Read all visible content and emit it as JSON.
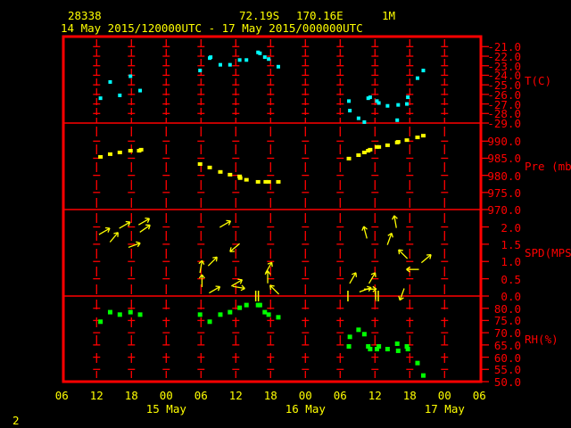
{
  "header": {
    "station": "28338",
    "latitude": "72.19S",
    "longitude": "170.16E",
    "elevation": "1M",
    "period": "14 May 2015/120000UTC - 17 May 2015/000000UTC"
  },
  "footer": {
    "page": "2"
  },
  "colors": {
    "frame": "#ff0000",
    "text": "#ffff00",
    "temperature": "#00ffff",
    "pressure": "#ffff00",
    "wind": "#ffff00",
    "humidity": "#00ff00"
  },
  "chart_data": {
    "type": "scatter",
    "x_axis": {
      "range": [
        "2015-05-14T06:00",
        "2015-05-17T06:00"
      ],
      "tick_labels": [
        "06",
        "12",
        "18",
        "00",
        "06",
        "12",
        "18",
        "00",
        "06",
        "12",
        "18",
        "00",
        "06"
      ],
      "date_labels": [
        {
          "label": "15 May",
          "at": "2015-05-15T00:00"
        },
        {
          "label": "16 May",
          "at": "2015-05-16T00:00"
        },
        {
          "label": "17 May",
          "at": "2015-05-17T00:00"
        }
      ]
    },
    "panels": [
      {
        "id": "temperature",
        "ylabel": "T(C)",
        "ylim": [
          -29,
          -21
        ],
        "tick_labels": [
          "-21.0",
          "-22.0",
          "-23.0",
          "-24.0",
          "-25.0",
          "-26.0",
          "-27.0",
          "-28.0",
          "-29.0"
        ],
        "tick_values": [
          -21,
          -22,
          -23,
          -24,
          -25,
          -26,
          -27,
          -28,
          -29
        ],
        "points": [
          {
            "t": "2015-05-14T12:40",
            "v": -26.4
          },
          {
            "t": "2015-05-14T14:20",
            "v": -24.7
          },
          {
            "t": "2015-05-14T16:00",
            "v": -26.1
          },
          {
            "t": "2015-05-14T17:50",
            "v": -24.1
          },
          {
            "t": "2015-05-14T19:30",
            "v": -25.6
          },
          {
            "t": "2015-05-15T05:50",
            "v": -23.5
          },
          {
            "t": "2015-05-15T07:30",
            "v": -22.2
          },
          {
            "t": "2015-05-15T07:40",
            "v": -22.1
          },
          {
            "t": "2015-05-15T09:20",
            "v": -22.9
          },
          {
            "t": "2015-05-15T11:00",
            "v": -22.9
          },
          {
            "t": "2015-05-15T12:40",
            "v": -22.4
          },
          {
            "t": "2015-05-15T13:50",
            "v": -22.4
          },
          {
            "t": "2015-05-15T15:50",
            "v": -21.6
          },
          {
            "t": "2015-05-15T16:10",
            "v": -21.7
          },
          {
            "t": "2015-05-15T17:00",
            "v": -22.1
          },
          {
            "t": "2015-05-15T17:40",
            "v": -22.3
          },
          {
            "t": "2015-05-15T19:20",
            "v": -23.1
          },
          {
            "t": "2015-05-16T07:30",
            "v": -26.7
          },
          {
            "t": "2015-05-16T07:40",
            "v": -27.7
          },
          {
            "t": "2015-05-16T09:10",
            "v": -28.5
          },
          {
            "t": "2015-05-16T10:10",
            "v": -28.9
          },
          {
            "t": "2015-05-16T10:50",
            "v": -26.4
          },
          {
            "t": "2015-05-16T11:10",
            "v": -26.3
          },
          {
            "t": "2015-05-16T12:20",
            "v": -26.7
          },
          {
            "t": "2015-05-16T12:40",
            "v": -26.9
          },
          {
            "t": "2015-05-16T14:10",
            "v": -27.2
          },
          {
            "t": "2015-05-16T15:50",
            "v": -28.7
          },
          {
            "t": "2015-05-16T16:00",
            "v": -27.1
          },
          {
            "t": "2015-05-16T17:30",
            "v": -27.0
          },
          {
            "t": "2015-05-16T17:40",
            "v": -26.3
          },
          {
            "t": "2015-05-16T19:20",
            "v": -24.3
          },
          {
            "t": "2015-05-16T20:20",
            "v": -23.5
          }
        ]
      },
      {
        "id": "pressure",
        "ylabel": "Pre (mb)",
        "ylim": [
          970,
          990
        ],
        "tick_labels": [
          "990.0",
          "985.0",
          "980.0",
          "975.0",
          "970.0"
        ],
        "tick_values": [
          990,
          985,
          980,
          975,
          970
        ],
        "points": [
          {
            "t": "2015-05-14T12:40",
            "v": 985.4
          },
          {
            "t": "2015-05-14T14:20",
            "v": 986.2
          },
          {
            "t": "2015-05-14T16:00",
            "v": 986.7
          },
          {
            "t": "2015-05-14T17:50",
            "v": 987.2
          },
          {
            "t": "2015-05-14T19:20",
            "v": 987.2
          },
          {
            "t": "2015-05-14T19:40",
            "v": 987.5
          },
          {
            "t": "2015-05-15T05:50",
            "v": 983.3
          },
          {
            "t": "2015-05-15T07:30",
            "v": 982.3
          },
          {
            "t": "2015-05-15T09:20",
            "v": 981.0
          },
          {
            "t": "2015-05-15T11:00",
            "v": 980.2
          },
          {
            "t": "2015-05-15T12:40",
            "v": 979.7
          },
          {
            "t": "2015-05-15T12:45",
            "v": 979.2
          },
          {
            "t": "2015-05-15T13:50",
            "v": 978.7
          },
          {
            "t": "2015-05-15T15:50",
            "v": 978.1
          },
          {
            "t": "2015-05-15T17:10",
            "v": 978.1
          },
          {
            "t": "2015-05-15T17:40",
            "v": 978.1
          },
          {
            "t": "2015-05-15T19:20",
            "v": 978.1
          },
          {
            "t": "2015-05-16T07:30",
            "v": 984.9
          },
          {
            "t": "2015-05-16T09:10",
            "v": 985.9
          },
          {
            "t": "2015-05-16T10:10",
            "v": 986.7
          },
          {
            "t": "2015-05-16T10:50",
            "v": 987.2
          },
          {
            "t": "2015-05-16T11:10",
            "v": 987.5
          },
          {
            "t": "2015-05-16T12:20",
            "v": 988.3
          },
          {
            "t": "2015-05-16T12:40",
            "v": 988.3
          },
          {
            "t": "2015-05-16T14:10",
            "v": 988.8
          },
          {
            "t": "2015-05-16T15:50",
            "v": 989.6
          },
          {
            "t": "2015-05-16T16:00",
            "v": 989.8
          },
          {
            "t": "2015-05-16T17:30",
            "v": 990.3
          },
          {
            "t": "2015-05-16T19:20",
            "v": 991.1
          },
          {
            "t": "2015-05-16T20:20",
            "v": 991.6
          }
        ]
      },
      {
        "id": "wind",
        "ylabel": "SPD(MPS)",
        "ylim": [
          0,
          2
        ],
        "tick_labels": [
          "2.0",
          "1.5",
          "1.0",
          "0.5",
          "0.0"
        ],
        "tick_values": [
          2,
          1.5,
          1,
          0.5,
          0
        ],
        "arrows": [
          {
            "t": "2015-05-14T13:20",
            "v": 1.87,
            "bearing": 60
          },
          {
            "t": "2015-05-14T15:00",
            "v": 1.7,
            "bearing": 40
          },
          {
            "t": "2015-05-14T16:50",
            "v": 2.05,
            "bearing": 60
          },
          {
            "t": "2015-05-14T20:10",
            "v": 2.15,
            "bearing": 60
          },
          {
            "t": "2015-05-14T20:20",
            "v": 1.95,
            "bearing": 55
          },
          {
            "t": "2015-05-14T18:30",
            "v": 1.47,
            "bearing": 70
          },
          {
            "t": "2015-05-15T10:10",
            "v": 2.08,
            "bearing": 60
          },
          {
            "t": "2015-05-15T11:50",
            "v": 1.4,
            "bearing": 230
          },
          {
            "t": "2015-05-15T06:00",
            "v": 0.85,
            "bearing": 10
          },
          {
            "t": "2015-05-15T08:00",
            "v": 1.0,
            "bearing": 45
          },
          {
            "t": "2015-05-15T06:10",
            "v": 0.44,
            "bearing": 0
          },
          {
            "t": "2015-05-15T08:20",
            "v": 0.18,
            "bearing": 60
          },
          {
            "t": "2015-05-15T12:10",
            "v": 0.38,
            "bearing": 60
          },
          {
            "t": "2015-05-15T12:30",
            "v": 0.25,
            "bearing": 100
          },
          {
            "t": "2015-05-15T17:40",
            "v": 0.82,
            "bearing": 30
          },
          {
            "t": "2015-05-15T17:30",
            "v": 0.55,
            "bearing": 0
          },
          {
            "t": "2015-05-15T18:40",
            "v": 0.18,
            "bearing": 315
          },
          {
            "t": "2015-05-16T15:30",
            "v": 2.15,
            "bearing": 350
          },
          {
            "t": "2015-05-16T10:20",
            "v": 1.84,
            "bearing": 345
          },
          {
            "t": "2015-05-16T14:30",
            "v": 1.65,
            "bearing": 20
          },
          {
            "t": "2015-05-16T16:50",
            "v": 1.21,
            "bearing": 315
          },
          {
            "t": "2015-05-16T20:50",
            "v": 1.08,
            "bearing": 50
          },
          {
            "t": "2015-05-16T18:30",
            "v": 0.77,
            "bearing": 270
          },
          {
            "t": "2015-05-16T08:10",
            "v": 0.52,
            "bearing": 30
          },
          {
            "t": "2015-05-16T11:30",
            "v": 0.52,
            "bearing": 30
          },
          {
            "t": "2015-05-16T10:20",
            "v": 0.18,
            "bearing": 70
          },
          {
            "t": "2015-05-16T11:10",
            "v": 0.2,
            "bearing": 90
          },
          {
            "t": "2015-05-16T16:40",
            "v": 0.05,
            "bearing": 200
          }
        ],
        "calm": [
          {
            "t": "2015-05-15T15:40",
            "count": 2
          },
          {
            "t": "2015-05-16T07:20",
            "count": 1
          },
          {
            "t": "2015-05-16T12:20",
            "count": 2
          }
        ]
      },
      {
        "id": "humidity",
        "ylabel": "RH(%)",
        "ylim": [
          50,
          80
        ],
        "tick_labels": [
          "80.0",
          "75.0",
          "70.0",
          "65.0",
          "60.0",
          "55.0",
          "50.0"
        ],
        "tick_values": [
          80,
          75,
          70,
          65,
          60,
          55,
          50
        ],
        "points": [
          {
            "t": "2015-05-14T12:40",
            "v": 74.5
          },
          {
            "t": "2015-05-14T14:20",
            "v": 78.4
          },
          {
            "t": "2015-05-14T16:00",
            "v": 77.4
          },
          {
            "t": "2015-05-14T17:50",
            "v": 78.4
          },
          {
            "t": "2015-05-14T19:30",
            "v": 77.4
          },
          {
            "t": "2015-05-15T05:50",
            "v": 77.4
          },
          {
            "t": "2015-05-15T07:30",
            "v": 74.5
          },
          {
            "t": "2015-05-15T09:20",
            "v": 77.4
          },
          {
            "t": "2015-05-15T11:00",
            "v": 78.4
          },
          {
            "t": "2015-05-15T12:40",
            "v": 80.2
          },
          {
            "t": "2015-05-15T13:50",
            "v": 81.3
          },
          {
            "t": "2015-05-15T15:50",
            "v": 81.3
          },
          {
            "t": "2015-05-15T16:10",
            "v": 81.3
          },
          {
            "t": "2015-05-15T17:00",
            "v": 78.4
          },
          {
            "t": "2015-05-15T17:40",
            "v": 77.4
          },
          {
            "t": "2015-05-15T19:20",
            "v": 76.3
          },
          {
            "t": "2015-05-16T07:40",
            "v": 68.3
          },
          {
            "t": "2015-05-16T07:30",
            "v": 64.4
          },
          {
            "t": "2015-05-16T09:10",
            "v": 71.2
          },
          {
            "t": "2015-05-16T10:10",
            "v": 69.4
          },
          {
            "t": "2015-05-16T10:50",
            "v": 64.4
          },
          {
            "t": "2015-05-16T11:10",
            "v": 63.3
          },
          {
            "t": "2015-05-16T12:20",
            "v": 63.3
          },
          {
            "t": "2015-05-16T12:40",
            "v": 64.4
          },
          {
            "t": "2015-05-16T14:10",
            "v": 63.3
          },
          {
            "t": "2015-05-16T15:50",
            "v": 65.5
          },
          {
            "t": "2015-05-16T16:00",
            "v": 62.6
          },
          {
            "t": "2015-05-16T17:30",
            "v": 64.4
          },
          {
            "t": "2015-05-16T17:40",
            "v": 63.3
          },
          {
            "t": "2015-05-16T19:20",
            "v": 57.6
          },
          {
            "t": "2015-05-16T20:20",
            "v": 52.5
          }
        ]
      }
    ]
  }
}
